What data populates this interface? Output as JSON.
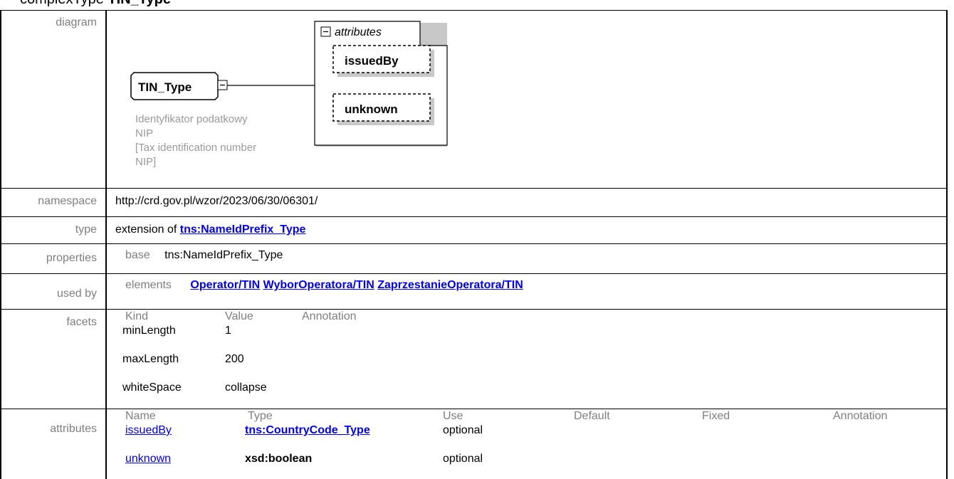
{
  "title": {
    "prefix": "complexType",
    "name": "TIN_Type"
  },
  "rows": {
    "diagram": "diagram",
    "namespace": "namespace",
    "type": "type",
    "properties": "properties",
    "used_by": "used by",
    "facets": "facets",
    "attributes": "attributes"
  },
  "diagram": {
    "element_name": "TIN_Type",
    "attributes_label": "attributes",
    "attr1": "issuedBy",
    "attr2": "unknown",
    "note_lines": [
      "Identyfikator podatkowy",
      "NIP",
      "[Tax identification number",
      "NIP]"
    ],
    "minus_icon": "collapse-minus-icon"
  },
  "namespace": "http://crd.gov.pl/wzor/2023/06/30/06301/",
  "type": {
    "prefix": "extension of ",
    "link": "tns:NameIdPrefix_Type"
  },
  "properties": {
    "key": "base",
    "value": "tns:NameIdPrefix_Type"
  },
  "used_by": {
    "kind": "elements",
    "links": [
      "Operator/TIN",
      "WyborOperatora/TIN",
      "ZaprzestanieOperatora/TIN"
    ]
  },
  "facets": {
    "headers": [
      "Kind",
      "Value",
      "Annotation"
    ],
    "rows": [
      {
        "kind": "minLength",
        "value": "1"
      },
      {
        "kind": "maxLength",
        "value": "200"
      },
      {
        "kind": "whiteSpace",
        "value": "collapse"
      }
    ]
  },
  "attributes": {
    "headers": [
      "Name",
      "Type",
      "Use",
      "Default",
      "Fixed",
      "Annotation"
    ],
    "rows": [
      {
        "name": "issuedBy",
        "type": "tns:CountryCode_Type",
        "use": "optional"
      },
      {
        "name": "unknown",
        "type": "xsd:boolean",
        "use": "optional"
      }
    ]
  },
  "colors": {
    "link": "#0000ee",
    "label": "#7f7f7f",
    "border": "#000000"
  }
}
